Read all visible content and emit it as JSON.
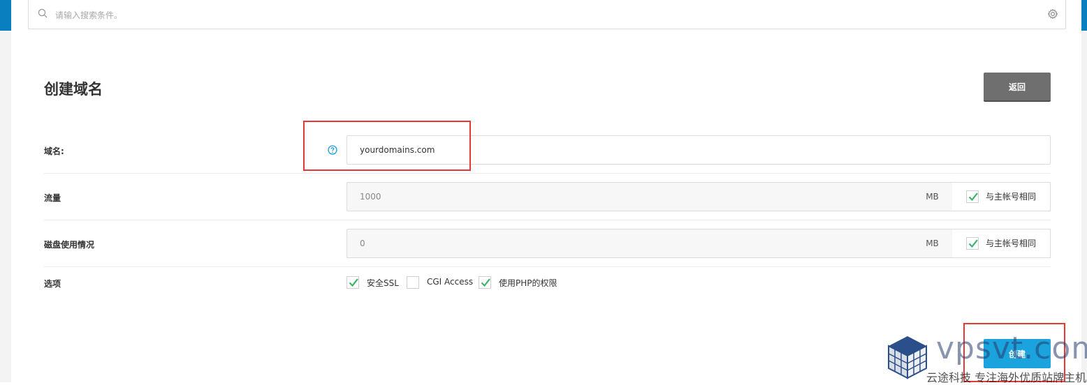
{
  "search": {
    "placeholder": "请输入搜索条件。"
  },
  "header": {
    "title": "创建域名",
    "back_label": "返回"
  },
  "form": {
    "domain": {
      "label": "域名:",
      "value": "yourdomains.com"
    },
    "bandwidth": {
      "label": "流量",
      "value": "1000",
      "unit": "MB",
      "same_label": "与主帐号相同",
      "same_checked": true
    },
    "disk": {
      "label": "磁盘使用情况",
      "value": "0",
      "unit": "MB",
      "same_label": "与主帐号相同",
      "same_checked": true
    },
    "options": {
      "label": "选项",
      "items": [
        {
          "label": "安全SSL",
          "checked": true
        },
        {
          "label": "CGI Access",
          "checked": false
        },
        {
          "label": "使用PHP的权限",
          "checked": true
        }
      ]
    }
  },
  "footer": {
    "create_label": "创建"
  },
  "watermark": {
    "url": "vpsvt.com",
    "tagline": "云途科技 专注海外优质站牌主机"
  },
  "colors": {
    "accent": "#1aa3dc",
    "check": "#3bb36b",
    "highlight": "#e53935",
    "back": "#6f6f6f"
  }
}
